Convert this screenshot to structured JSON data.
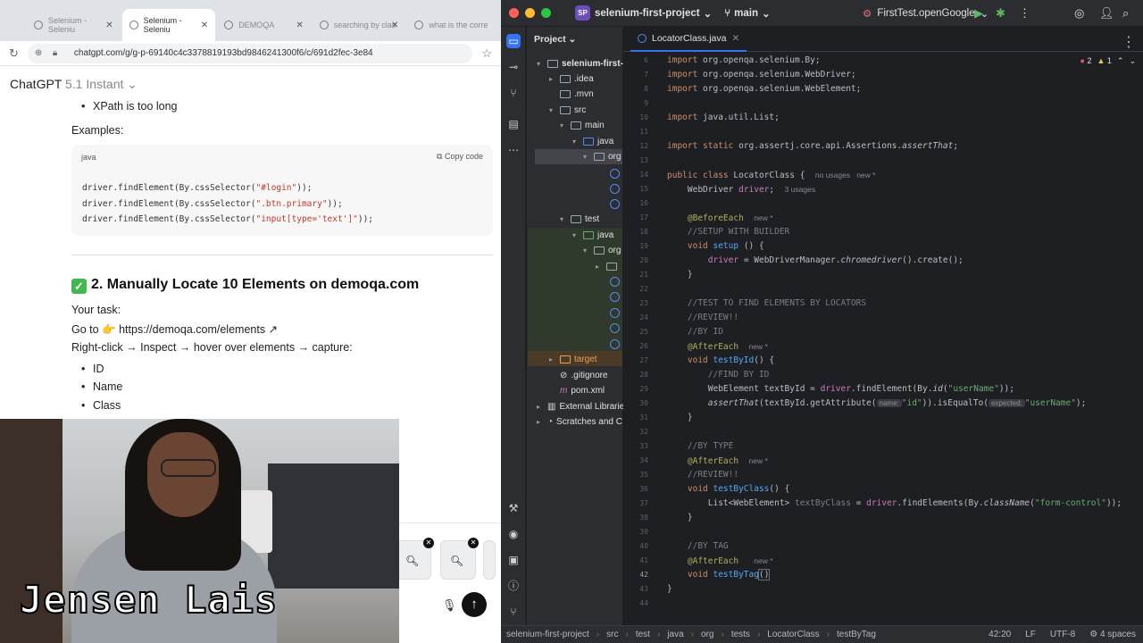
{
  "browser": {
    "tabs": [
      {
        "label": "Selenium - Seleniu"
      },
      {
        "label": "Selenium - Seleniu"
      },
      {
        "label": "DEMOQA"
      },
      {
        "label": "searching by clas"
      },
      {
        "label": "what is the corre"
      }
    ],
    "url": "chatgpt.com/g/g-p-69140c4c3378819193bd9846241300f6/c/691d2fec-3e84"
  },
  "chatgpt": {
    "title": "ChatGPT",
    "version": "5.1 Instant",
    "bullet_xpath": "XPath is too long",
    "examples_label": "Examples:",
    "code": {
      "lang": "java",
      "copy_label": "Copy code",
      "line1_pre": "driver.findElement(By.cssSelector(",
      "line1_str": "\"#login\"",
      "line1_post": "));",
      "line2_pre": "driver.findElement(By.cssSelector(",
      "line2_str": "\".btn.primary\"",
      "line2_post": "));",
      "line3_pre": "driver.findElement(By.cssSelector(",
      "line3_str": "\"input[type='text']\"",
      "line3_post": "));"
    },
    "heading": "2. Manually Locate 10 Elements on demoqa.com",
    "task_label": "Your task:",
    "goto_text": "Go to 👉 ",
    "goto_link": "https://demoqa.com/elements ↗",
    "rightclick": "Right-click → Inspect → hover over elements → capture:",
    "list": [
      "ID",
      "Name",
      "Class"
    ]
  },
  "webcam": {
    "caption": "Jensen Lais"
  },
  "ide": {
    "project_badge": "SP",
    "project_name": "selenium-first-project",
    "branch": "main",
    "run_config": "FirstTest.openGoogle",
    "panel_title": "Project",
    "tab_title": "LocatorClass.java",
    "errors": "2",
    "warnings": "1",
    "tree": {
      "root": "selenium-first-p",
      "idea": ".idea",
      "mvn": ".mvn",
      "src": "src",
      "main": "main",
      "java": "java",
      "org": "org",
      "test": "test",
      "test_java": "java",
      "test_org": "org",
      "target": "target",
      "gitignore": ".gitignore",
      "pom": "pom.xml",
      "ext": "External Librarie",
      "scratches": "Scratches and C"
    },
    "code": {
      "l6_a": "import",
      "l6_b": " org.openqa.selenium.By;",
      "l7_a": "import",
      "l7_b": " org.openqa.selenium.WebDriver;",
      "l8_a": "import",
      "l8_b": " org.openqa.selenium.WebElement;",
      "l10_a": "import",
      "l10_b": " java.util.List;",
      "l12_a": "import static",
      "l12_b": " org.assertj.core.api.Assertions.",
      "l12_c": "assertThat",
      "l12_d": ";",
      "l14_a": "public class",
      "l14_b": " LocatorClass {",
      "l14_h": "no usages   new *",
      "l15_a": "    WebDriver ",
      "l15_b": "driver",
      "l15_c": ";",
      "l15_h": "3 usages",
      "l17_a": "    @BeforeEach",
      "l17_h": "new *",
      "l18": "    //SETUP WITH BUILDER",
      "l19_a": "    void ",
      "l19_b": "setup",
      "l19_c": " () {",
      "l20_a": "        ",
      "l20_b": "driver",
      "l20_c": " = WebDriverManager.",
      "l20_d": "chromedriver",
      "l20_e": "().create();",
      "l21": "    }",
      "l23": "    //TEST TO FIND ELEMENTS BY LOCATORS",
      "l24": "    //REVIEW!!",
      "l25": "    //BY ID",
      "l26_a": "    @AfterEach",
      "l26_h": "new *",
      "l27_a": "    void ",
      "l27_b": "testById",
      "l27_c": "() {",
      "l28": "        //FIND BY ID",
      "l29_a": "        WebElement textById = ",
      "l29_b": "driver",
      "l29_c": ".findElement(By.",
      "l29_d": "id",
      "l29_e": "(",
      "l29_f": "\"userName\"",
      "l29_g": "));",
      "l30_a": "        ",
      "l30_b": "assertThat",
      "l30_c": "(textById.getAttribute(",
      "l30_p1": "name:",
      "l30_d": "\"id\"",
      "l30_e": ")).isEqualTo(",
      "l30_p2": "expected:",
      "l30_f": "\"userName\"",
      "l30_g": ");",
      "l31": "    }",
      "l33": "    //BY TYPE",
      "l34_a": "    @AfterEach",
      "l34_h": "new *",
      "l35": "    //REVIEW!!",
      "l36_a": "    void ",
      "l36_b": "testByClass",
      "l36_c": "() {",
      "l37_a": "        List<WebElement> ",
      "l37_b": "textByClass",
      "l37_c": " = ",
      "l37_d": "driver",
      "l37_e": ".findElements(By.",
      "l37_f": "className",
      "l37_g": "(",
      "l37_h": "\"form-control\"",
      "l37_i": "));",
      "l38": "    }",
      "l40": "    //BY TAG",
      "l41_a": "    @AfterEach",
      "l41_h": "new *",
      "l42_a": "    void ",
      "l42_b": "testByTag",
      "l42_c": "()",
      "l43": "}"
    },
    "status": {
      "crumbs": [
        "selenium-first-project",
        "src",
        "test",
        "java",
        "org",
        "tests",
        "LocatorClass",
        "testByTag"
      ],
      "position": "42:20",
      "line_sep": "LF",
      "encoding": "UTF-8",
      "indent": "4 spaces"
    }
  }
}
